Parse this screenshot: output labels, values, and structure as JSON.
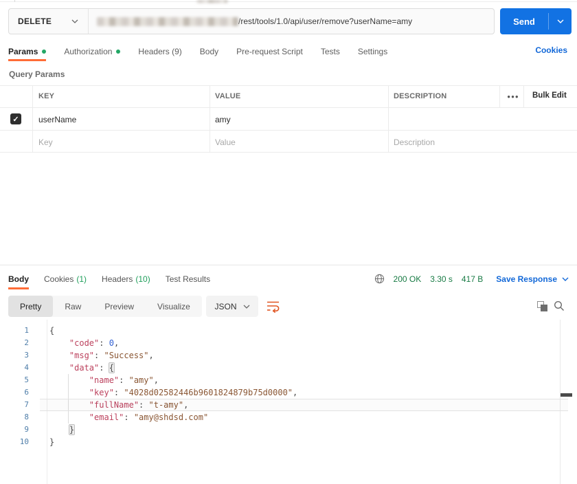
{
  "colors": {
    "accent_orange": "#ff6c37",
    "primary_blue": "#1272e3",
    "link_blue": "#1268d8",
    "success_green": "#1e9e5a",
    "status_green": "#177a43",
    "code_key": "#bc415d",
    "code_string": "#8a5633",
    "code_number": "#2f5fd3",
    "line_number_blue": "#4f7ea9"
  },
  "request": {
    "method": "DELETE",
    "url_host_redacted": true,
    "url_path": "/rest/tools/1.0/api/user/remove?userName=amy",
    "send_label": "Send",
    "tabs": [
      {
        "label": "Params",
        "dot": true,
        "active": true
      },
      {
        "label": "Authorization",
        "dot": true
      },
      {
        "label": "Headers (9)"
      },
      {
        "label": "Body"
      },
      {
        "label": "Pre-request Script"
      },
      {
        "label": "Tests"
      },
      {
        "label": "Settings"
      }
    ],
    "cookies_link": "Cookies",
    "section_label": "Query Params",
    "table": {
      "headers": {
        "key": "KEY",
        "value": "VALUE",
        "description": "DESCRIPTION"
      },
      "bulk_edit_label": "Bulk Edit",
      "rows": [
        {
          "checked": true,
          "key": "userName",
          "value": "amy",
          "description": ""
        }
      ],
      "placeholders": {
        "key": "Key",
        "value": "Value",
        "description": "Description"
      }
    }
  },
  "response": {
    "tabs": [
      {
        "label": "Body",
        "active": true
      },
      {
        "label": "Cookies",
        "count": "(1)"
      },
      {
        "label": "Headers",
        "count": "(10)"
      },
      {
        "label": "Test Results"
      }
    ],
    "status": {
      "code": "200 OK",
      "time": "3.30 s",
      "size": "417 B"
    },
    "save_response_label": "Save Response",
    "views": [
      "Pretty",
      "Raw",
      "Preview",
      "Visualize"
    ],
    "active_view": "Pretty",
    "language": "JSON",
    "body": {
      "code": 0,
      "msg": "Success",
      "data": {
        "name": "amy",
        "key": "4028d02582446b9601824879b75d0000",
        "fullName": "t-amy",
        "email": "amy@shdsd.com"
      }
    },
    "code_lines": [
      {
        "n": 1,
        "tokens": [
          [
            "p",
            "{"
          ]
        ]
      },
      {
        "n": 2,
        "tokens": [
          [
            "w",
            "    "
          ],
          [
            "k",
            "\"code\""
          ],
          [
            "p",
            ": "
          ],
          [
            "n",
            "0"
          ],
          [
            "p",
            ","
          ]
        ]
      },
      {
        "n": 3,
        "tokens": [
          [
            "w",
            "    "
          ],
          [
            "k",
            "\"msg\""
          ],
          [
            "p",
            ": "
          ],
          [
            "s",
            "\"Success\""
          ],
          [
            "p",
            ","
          ]
        ]
      },
      {
        "n": 4,
        "tokens": [
          [
            "w",
            "    "
          ],
          [
            "k",
            "\"data\""
          ],
          [
            "p",
            ": "
          ],
          [
            "b",
            "{"
          ]
        ]
      },
      {
        "n": 5,
        "tokens": [
          [
            "w",
            "        "
          ],
          [
            "k",
            "\"name\""
          ],
          [
            "p",
            ": "
          ],
          [
            "s",
            "\"amy\""
          ],
          [
            "p",
            ","
          ]
        ]
      },
      {
        "n": 6,
        "tokens": [
          [
            "w",
            "        "
          ],
          [
            "k",
            "\"key\""
          ],
          [
            "p",
            ": "
          ],
          [
            "s",
            "\"4028d02582446b9601824879b75d0000\""
          ],
          [
            "p",
            ","
          ]
        ]
      },
      {
        "n": 7,
        "active": true,
        "tokens": [
          [
            "w",
            "        "
          ],
          [
            "k",
            "\"fullName\""
          ],
          [
            "p",
            ": "
          ],
          [
            "s",
            "\"t-amy\""
          ],
          [
            "p",
            ","
          ]
        ]
      },
      {
        "n": 8,
        "tokens": [
          [
            "w",
            "        "
          ],
          [
            "k",
            "\"email\""
          ],
          [
            "p",
            ": "
          ],
          [
            "s",
            "\"amy@shdsd.com\""
          ]
        ]
      },
      {
        "n": 9,
        "tokens": [
          [
            "w",
            "    "
          ],
          [
            "b",
            "}"
          ]
        ]
      },
      {
        "n": 10,
        "tokens": [
          [
            "p",
            "}"
          ]
        ]
      }
    ]
  }
}
